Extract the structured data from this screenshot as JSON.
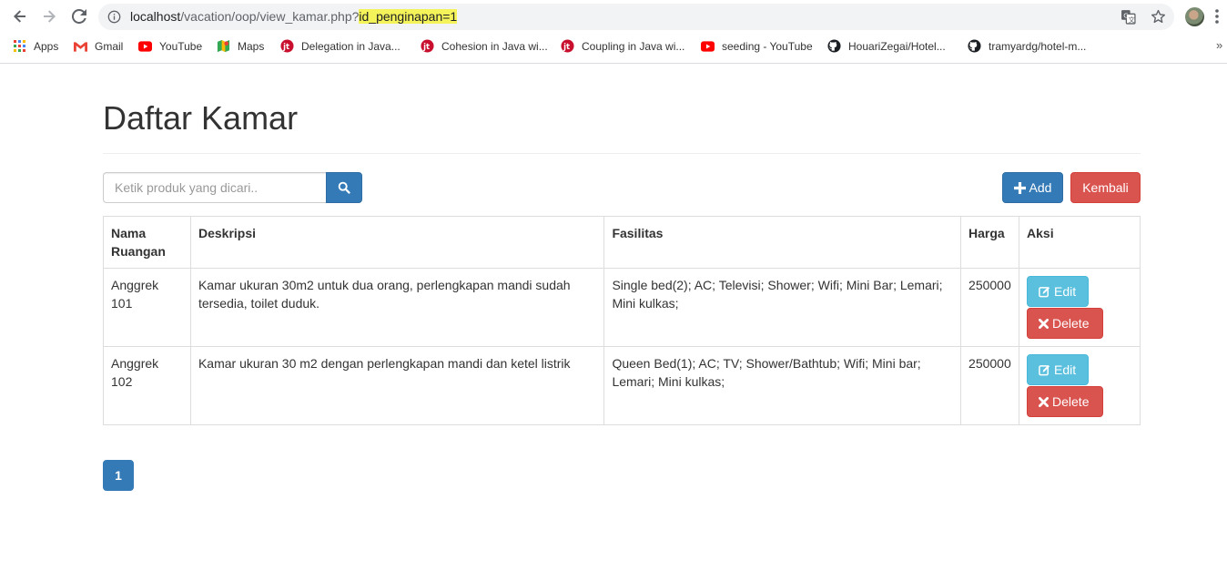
{
  "browser": {
    "url_host": "localhost",
    "url_path": "/vacation/oop/view_kamar.php?",
    "url_query": "id_penginapan=1",
    "bookmarks": [
      {
        "label": "Apps",
        "icon": "apps-grid-icon"
      },
      {
        "label": "Gmail",
        "icon": "gmail-icon"
      },
      {
        "label": "YouTube",
        "icon": "youtube-icon"
      },
      {
        "label": "Maps",
        "icon": "maps-icon"
      },
      {
        "label": "Delegation in Java...",
        "icon": "javatpoint-icon"
      },
      {
        "label": "Cohesion in Java wi...",
        "icon": "javatpoint-icon"
      },
      {
        "label": "Coupling in Java wi...",
        "icon": "javatpoint-icon"
      },
      {
        "label": "seeding - YouTube",
        "icon": "youtube-icon"
      },
      {
        "label": "HouariZegai/Hotel...",
        "icon": "github-icon"
      },
      {
        "label": "tramyardg/hotel-m...",
        "icon": "github-icon"
      }
    ],
    "more": "»"
  },
  "page": {
    "title": "Daftar Kamar",
    "search": {
      "placeholder": "Ketik produk yang dicari.."
    },
    "add_label": "Add",
    "back_label": "Kembali",
    "table": {
      "headers": [
        "Nama Ruangan",
        "Deskripsi",
        "Fasilitas",
        "Harga",
        "Aksi"
      ],
      "rows": [
        {
          "nama": "Anggrek 101",
          "deskripsi": "Kamar ukuran 30m2 untuk dua orang, perlengkapan mandi sudah tersedia, toilet duduk.",
          "fasilitas": "Single bed(2); AC; Televisi; Shower; Wifi; Mini Bar; Lemari; Mini kulkas;",
          "harga": "250000",
          "edit_label": "Edit",
          "delete_label": "Delete"
        },
        {
          "nama": "Anggrek 102",
          "deskripsi": "Kamar ukuran 30 m2 dengan perlengkapan mandi dan ketel listrik",
          "fasilitas": "Queen Bed(1); AC; TV; Shower/Bathtub; Wifi; Mini bar; Lemari; Mini kulkas;",
          "harga": "250000",
          "edit_label": "Edit",
          "delete_label": "Delete"
        }
      ]
    },
    "pagination": {
      "current": "1"
    }
  },
  "colors": {
    "primary": "#337ab7",
    "danger": "#d9534f",
    "info": "#5bc0de",
    "url_highlight": "#f4f45a"
  }
}
